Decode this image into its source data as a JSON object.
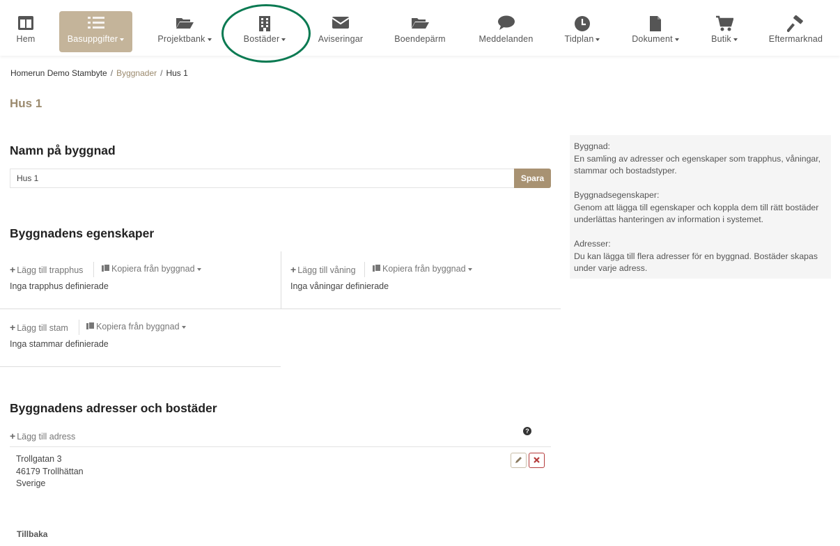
{
  "nav": {
    "items": [
      {
        "label": "Hem",
        "icon": "columns-icon",
        "dropdown": false
      },
      {
        "label": "Basuppgifter",
        "icon": "list-icon",
        "dropdown": true,
        "active": true
      },
      {
        "label": "Projektbank",
        "icon": "folder-open-icon",
        "dropdown": true
      },
      {
        "label": "Bostäder",
        "icon": "building-icon",
        "dropdown": true
      },
      {
        "label": "Aviseringar",
        "icon": "envelope-icon",
        "dropdown": false
      },
      {
        "label": "Boendepärm",
        "icon": "folder-open-icon",
        "dropdown": false
      },
      {
        "label": "Meddelanden",
        "icon": "comment-icon",
        "dropdown": false
      },
      {
        "label": "Tidplan",
        "icon": "clock-icon",
        "dropdown": true
      },
      {
        "label": "Dokument",
        "icon": "file-icon",
        "dropdown": true
      },
      {
        "label": "Butik",
        "icon": "cart-icon",
        "dropdown": true
      },
      {
        "label": "Eftermarknad",
        "icon": "hammer-icon",
        "dropdown": false
      }
    ],
    "active_color": "#c4b49a",
    "highlight_color": "#0b7a52"
  },
  "breadcrumb": {
    "project": "Homerun Demo Stambyte",
    "buildings": "Byggnader",
    "current": "Hus 1"
  },
  "page_title": "Hus 1",
  "name_section": {
    "heading": "Namn på byggnad",
    "value": "Hus 1",
    "save_label": "Spara"
  },
  "properties": {
    "heading": "Byggnadens egenskaper",
    "copy_label": "Kopiera från byggnad",
    "stairs": {
      "add_label": "Lägg till trapphus",
      "empty": "Inga trapphus definierade"
    },
    "floors": {
      "add_label": "Lägg till våning",
      "empty": "Inga våningar definierade"
    },
    "stacks": {
      "add_label": "Lägg till stam",
      "empty": "Inga stammar definierade"
    }
  },
  "addresses": {
    "heading": "Byggnadens adresser och bostäder",
    "add_label": "Lägg till adress",
    "help": "?",
    "items": [
      {
        "street": "Trollgatan 3",
        "postal": "46179 Trollhättan",
        "country": "Sverige"
      }
    ]
  },
  "back_label": "Tillbaka",
  "info": {
    "building_title": "Byggnad:",
    "building_text": "En samling av adresser och egenskaper som trapphus, våningar, stammar och bostadstyper.",
    "props_title": "Byggnadsegenskaper:",
    "props_text": "Genom att lägga till egenskaper och koppla dem till rätt bostäder underlättas hanteringen av information i systemet.",
    "addr_title": "Adresser:",
    "addr_text": "Du kan lägga till flera adresser för en byggnad. Bostäder skapas under varje adress."
  },
  "colors": {
    "accent": "#a89272",
    "link": "#9b8a6e",
    "danger": "#b43b3b"
  }
}
